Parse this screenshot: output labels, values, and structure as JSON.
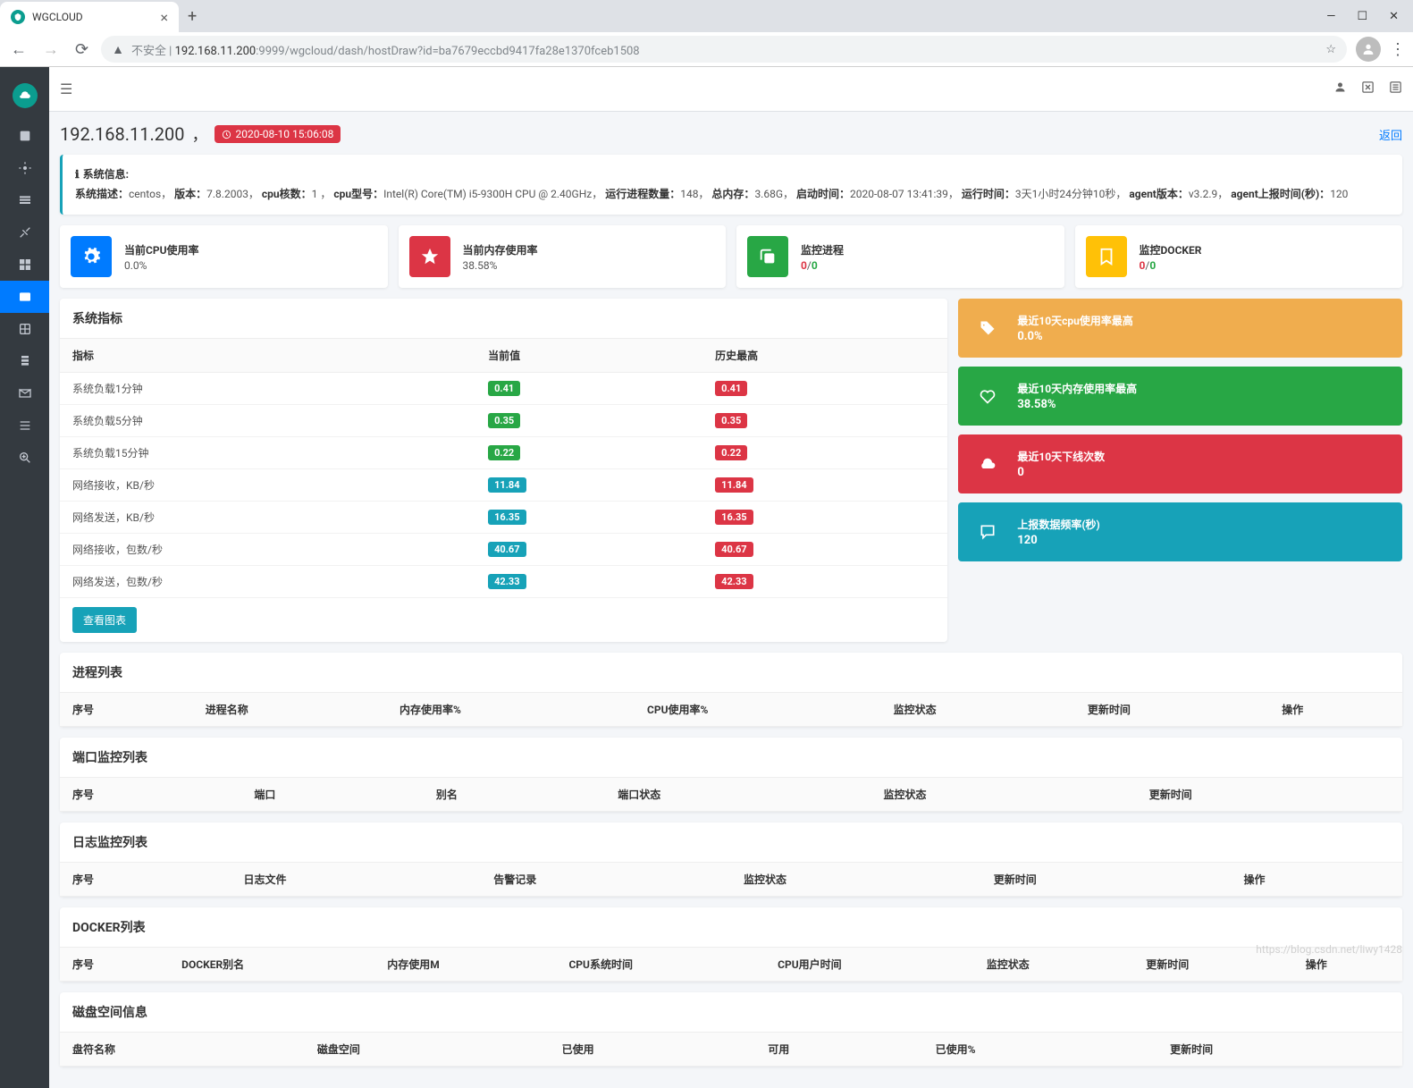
{
  "browser": {
    "tab_title": "WGCLOUD",
    "url_prefix": "不安全 | ",
    "url_host": "192.168.11.200",
    "url_rest": ":9999/wgcloud/dash/hostDraw?id=ba7679eccbd9417fa28e1370fceb1508"
  },
  "breadcrumb": {
    "ip": "192.168.11.200",
    "comma": "，",
    "timestamp": "2020-08-10 15:06:08",
    "back": "返回"
  },
  "sysinfo": {
    "title": "系统信息:",
    "desc_k": "系统描述：",
    "desc_v": "centos，",
    "ver_k": "版本：",
    "ver_v": "7.8.2003，",
    "cores_k": "cpu核数：",
    "cores_v": "1 ，",
    "model_k": "cpu型号：",
    "model_v": "Intel(R) Core(TM) i5-9300H CPU @ 2.40GHz，",
    "proc_k": "运行进程数量：",
    "proc_v": "148，",
    "mem_k": "总内存：",
    "mem_v": "3.68G，",
    "start_k": "启动时间：",
    "start_v": "2020-08-07 13:41:39，",
    "run_k": "运行时间：",
    "run_v": "3天1小时24分钟10秒，",
    "agentv_k": "agent版本：",
    "agentv_v": "v3.2.9，",
    "report_k": "agent上报时间(秒)：",
    "report_v": "120"
  },
  "stats": [
    {
      "label": "当前CPU使用率",
      "value": "0.0%",
      "color": "#007bff",
      "icon": "gear"
    },
    {
      "label": "当前内存使用率",
      "value": "38.58%",
      "color": "#dc3545",
      "icon": "star"
    },
    {
      "label": "监控进程",
      "value_a": "0",
      "value_b": "0",
      "color": "#28a745",
      "icon": "copy"
    },
    {
      "label": "监控DOCKER",
      "value_a": "0",
      "value_b": "0",
      "color": "#ffc107",
      "icon": "bookmark"
    }
  ],
  "metrics": {
    "title": "系统指标",
    "headers": [
      "指标",
      "当前值",
      "历史最高"
    ],
    "rows": [
      {
        "name": "系统负载1分钟",
        "cur": "0.41",
        "max": "0.41",
        "curCls": "bg-green",
        "maxCls": "bg-red"
      },
      {
        "name": "系统负载5分钟",
        "cur": "0.35",
        "max": "0.35",
        "curCls": "bg-green",
        "maxCls": "bg-red"
      },
      {
        "name": "系统负载15分钟",
        "cur": "0.22",
        "max": "0.22",
        "curCls": "bg-green",
        "maxCls": "bg-red"
      },
      {
        "name": "网络接收，KB/秒",
        "cur": "11.84",
        "max": "11.84",
        "curCls": "bg-info",
        "maxCls": "bg-red"
      },
      {
        "name": "网络发送，KB/秒",
        "cur": "16.35",
        "max": "16.35",
        "curCls": "bg-info",
        "maxCls": "bg-red"
      },
      {
        "name": "网络接收，包数/秒",
        "cur": "40.67",
        "max": "40.67",
        "curCls": "bg-info",
        "maxCls": "bg-red"
      },
      {
        "name": "网络发送，包数/秒",
        "cur": "42.33",
        "max": "42.33",
        "curCls": "bg-info",
        "maxCls": "bg-red"
      }
    ],
    "view_btn": "查看图表"
  },
  "highlights": [
    {
      "title": "最近10天cpu使用率最高",
      "value": "0.0%",
      "cls": "bg-yellow",
      "icon": "tag"
    },
    {
      "title": "最近10天内存使用率最高",
      "value": "38.58%",
      "cls": "bg-green2",
      "icon": "heart"
    },
    {
      "title": "最近10天下线次数",
      "value": "0",
      "cls": "bg-red2",
      "icon": "cloud"
    },
    {
      "title": "上报数据频率(秒)",
      "value": "120",
      "cls": "bg-teal",
      "icon": "chat"
    }
  ],
  "sections": {
    "process": {
      "title": "进程列表",
      "headers": [
        "序号",
        "进程名称",
        "内存使用率%",
        "CPU使用率%",
        "监控状态",
        "更新时间",
        "操作"
      ]
    },
    "port": {
      "title": "端口监控列表",
      "headers": [
        "序号",
        "端口",
        "别名",
        "端口状态",
        "监控状态",
        "更新时间"
      ]
    },
    "log": {
      "title": "日志监控列表",
      "headers": [
        "序号",
        "日志文件",
        "告警记录",
        "监控状态",
        "更新时间",
        "操作"
      ]
    },
    "docker": {
      "title": "DOCKER列表",
      "headers": [
        "序号",
        "DOCKER别名",
        "内存使用M",
        "CPU系统时间",
        "CPU用户时间",
        "监控状态",
        "更新时间",
        "操作"
      ]
    },
    "disk": {
      "title": "磁盘空间信息",
      "headers": [
        "盘符名称",
        "磁盘空间",
        "已使用",
        "可用",
        "已使用%",
        "更新时间"
      ]
    }
  },
  "watermark": "https://blog.csdn.net/liwy1428"
}
